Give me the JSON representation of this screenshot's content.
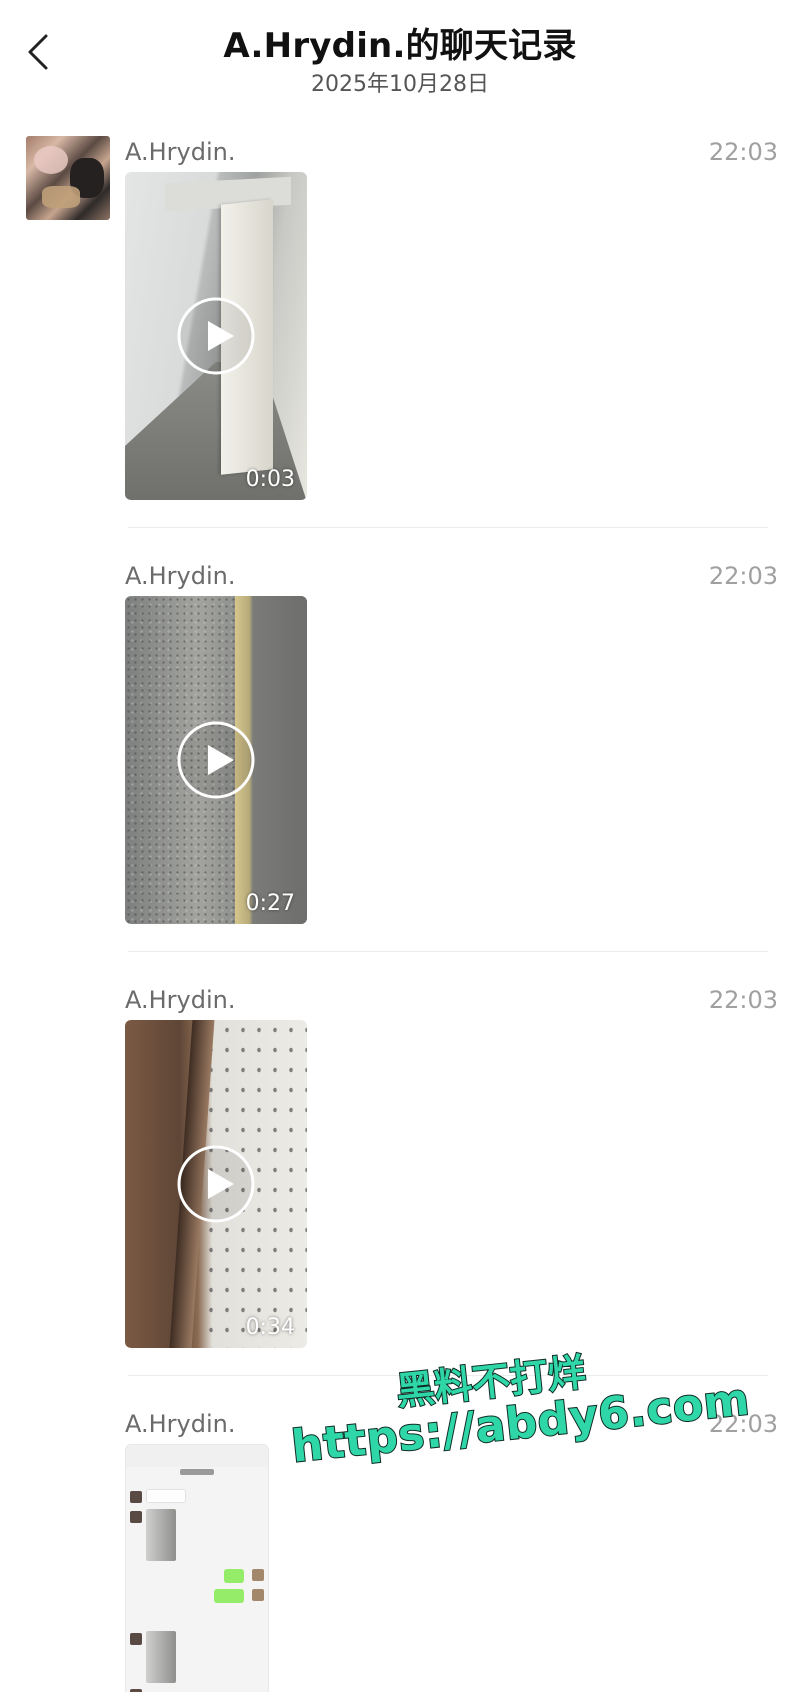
{
  "header": {
    "title": "A.Hrydin.的聊天记录",
    "date": "2025年10月28日"
  },
  "messages": [
    {
      "sender": "A.Hrydin.",
      "time": "22:03",
      "type": "video",
      "duration": "0:03"
    },
    {
      "sender": "A.Hrydin.",
      "time": "22:03",
      "type": "video",
      "duration": "0:27"
    },
    {
      "sender": "A.Hrydin.",
      "time": "22:03",
      "type": "video",
      "duration": "0:34"
    },
    {
      "sender": "A.Hrydin.",
      "time": "22:03",
      "type": "image"
    }
  ],
  "watermark": {
    "line1": "黑料不打烊",
    "line2": "https://abdy6.com"
  },
  "colors": {
    "watermark_fill": "#2fd6a8",
    "time_text": "#a0a0a0",
    "sender_text": "#6b6b6b"
  }
}
